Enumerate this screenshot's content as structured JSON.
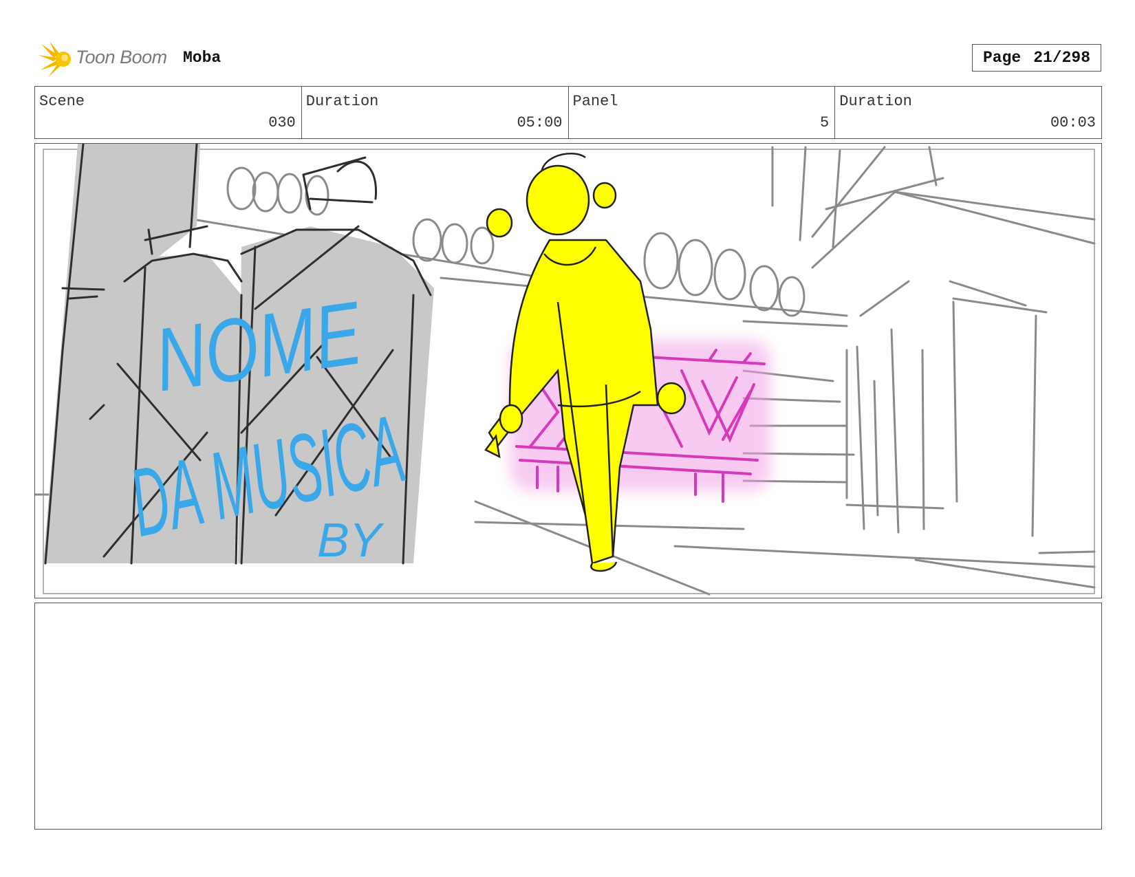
{
  "header": {
    "logo_text": "Toon Boom",
    "project_name": "Moba",
    "page_label": "Page",
    "page_number": "21/298"
  },
  "info": {
    "scene_label": "Scene",
    "scene_value": "030",
    "scene_duration_label": "Duration",
    "scene_duration_value": "05:00",
    "panel_label": "Panel",
    "panel_value": "5",
    "panel_duration_label": "Duration",
    "panel_duration_value": "00:03"
  },
  "sketch": {
    "graffiti_line1": "NOME",
    "graffiti_line2": "DA MUSICA",
    "graffiti_line3": "BY"
  },
  "colors": {
    "character": "#ffff00",
    "graffiti": "#3aa8e8",
    "neon_sign": "#e040c0",
    "canister": "#c8c8c8",
    "line": "#333333"
  }
}
